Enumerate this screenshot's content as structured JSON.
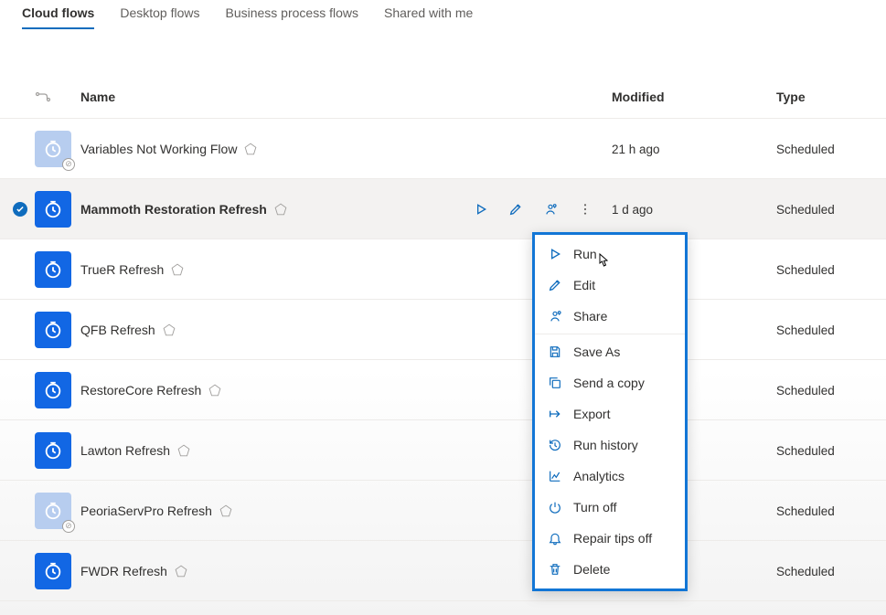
{
  "tabs": [
    {
      "label": "Cloud flows",
      "active": true
    },
    {
      "label": "Desktop flows",
      "active": false
    },
    {
      "label": "Business process flows",
      "active": false
    },
    {
      "label": "Shared with me",
      "active": false
    }
  ],
  "columns": {
    "name": "Name",
    "modified": "Modified",
    "type": "Type"
  },
  "rows": [
    {
      "name": "Variables Not Working Flow",
      "modified": "21 h ago",
      "type": "Scheduled",
      "disabled": true,
      "selected": false,
      "premium": true
    },
    {
      "name": "Mammoth Restoration Refresh",
      "modified": "1 d ago",
      "type": "Scheduled",
      "disabled": false,
      "selected": true,
      "premium": true
    },
    {
      "name": "TrueR Refresh",
      "modified": "",
      "type": "Scheduled",
      "disabled": false,
      "selected": false,
      "premium": true
    },
    {
      "name": "QFB Refresh",
      "modified": "",
      "type": "Scheduled",
      "disabled": false,
      "selected": false,
      "premium": true
    },
    {
      "name": "RestoreCore Refresh",
      "modified": "",
      "type": "Scheduled",
      "disabled": false,
      "selected": false,
      "premium": true
    },
    {
      "name": "Lawton Refresh",
      "modified": "",
      "type": "Scheduled",
      "disabled": false,
      "selected": false,
      "premium": true
    },
    {
      "name": "PeoriaServPro Refresh",
      "modified": "",
      "type": "Scheduled",
      "disabled": true,
      "selected": false,
      "premium": true
    },
    {
      "name": "FWDR Refresh",
      "modified": "",
      "type": "Scheduled",
      "disabled": false,
      "selected": false,
      "premium": true
    }
  ],
  "context_menu": [
    {
      "icon": "run",
      "label": "Run"
    },
    {
      "icon": "edit",
      "label": "Edit"
    },
    {
      "icon": "share",
      "label": "Share"
    },
    {
      "divider": true
    },
    {
      "icon": "saveas",
      "label": "Save As"
    },
    {
      "icon": "copy",
      "label": "Send a copy"
    },
    {
      "icon": "export",
      "label": "Export"
    },
    {
      "icon": "history",
      "label": "Run history"
    },
    {
      "icon": "analytics",
      "label": "Analytics"
    },
    {
      "icon": "turnoff",
      "label": "Turn off"
    },
    {
      "icon": "bell",
      "label": "Repair tips off"
    },
    {
      "icon": "delete",
      "label": "Delete"
    }
  ]
}
